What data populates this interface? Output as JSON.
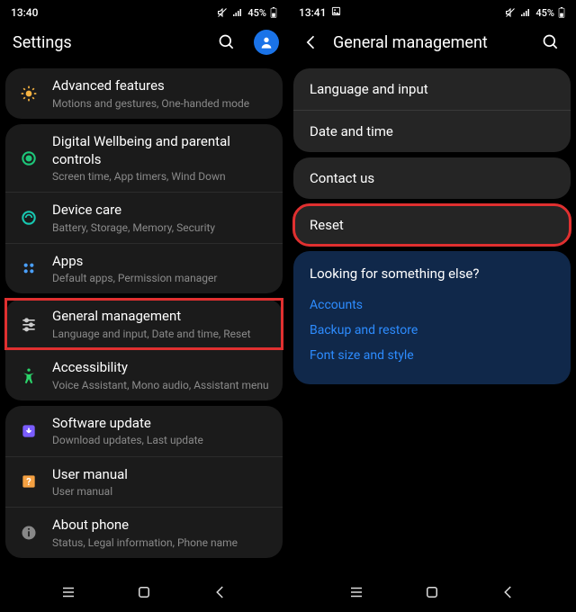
{
  "left": {
    "statusbar": {
      "time": "13:40",
      "battery": "45%"
    },
    "header": {
      "title": "Settings"
    },
    "groups": [
      [
        {
          "icon": "advanced",
          "title": "Advanced features",
          "subtitle": "Motions and gestures, One-handed mode"
        }
      ],
      [
        {
          "icon": "wellbeing",
          "title": "Digital Wellbeing and parental controls",
          "subtitle": "Screen time, App timers, Wind Down"
        },
        {
          "icon": "devicecare",
          "title": "Device care",
          "subtitle": "Battery, Storage, Memory, Security"
        },
        {
          "icon": "apps",
          "title": "Apps",
          "subtitle": "Default apps, Permission manager"
        }
      ],
      [
        {
          "icon": "general",
          "title": "General management",
          "subtitle": "Language and input, Date and time, Reset",
          "highlight": true
        },
        {
          "icon": "accessibility",
          "title": "Accessibility",
          "subtitle": "Voice Assistant, Mono audio, Assistant menu"
        }
      ],
      [
        {
          "icon": "update",
          "title": "Software update",
          "subtitle": "Download updates, Last update"
        },
        {
          "icon": "manual",
          "title": "User manual",
          "subtitle": "User manual"
        },
        {
          "icon": "about",
          "title": "About phone",
          "subtitle": "Status, Legal information, Phone name"
        }
      ]
    ]
  },
  "right": {
    "statusbar": {
      "time": "13:41",
      "battery": "45%"
    },
    "header": {
      "title": "General management"
    },
    "group1": [
      "Language and input",
      "Date and time"
    ],
    "contact": "Contact us",
    "reset": "Reset",
    "suggest": {
      "header": "Looking for something else?",
      "links": [
        "Accounts",
        "Backup and restore",
        "Font size and style"
      ]
    }
  }
}
